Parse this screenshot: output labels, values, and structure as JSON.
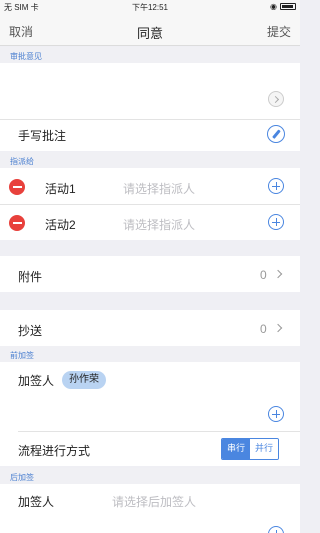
{
  "status_bar": {
    "carrier": "无 SIM 卡",
    "time": "下午12:51"
  },
  "nav": {
    "cancel": "取消",
    "title": "同意",
    "submit": "提交"
  },
  "opinion": {
    "header": "审批意见",
    "handwritten_label": "手写批注"
  },
  "assign": {
    "header": "指派给",
    "rows": [
      {
        "label": "活动1",
        "placeholder": "请选择指派人"
      },
      {
        "label": "活动2",
        "placeholder": "请选择指派人"
      }
    ]
  },
  "attachment": {
    "label": "附件",
    "count": "0"
  },
  "cc": {
    "label": "抄送",
    "count": "0"
  },
  "pre_sign": {
    "header": "前加签",
    "label": "加签人",
    "chip": "孙作荣",
    "flow_label": "流程进行方式",
    "serial": "串行",
    "parallel": "并行"
  },
  "post_sign": {
    "header": "后加签",
    "label": "加签人",
    "placeholder": "请选择后加签人"
  },
  "colors": {
    "accent": "#4a86e0",
    "danger": "#e8413c"
  }
}
